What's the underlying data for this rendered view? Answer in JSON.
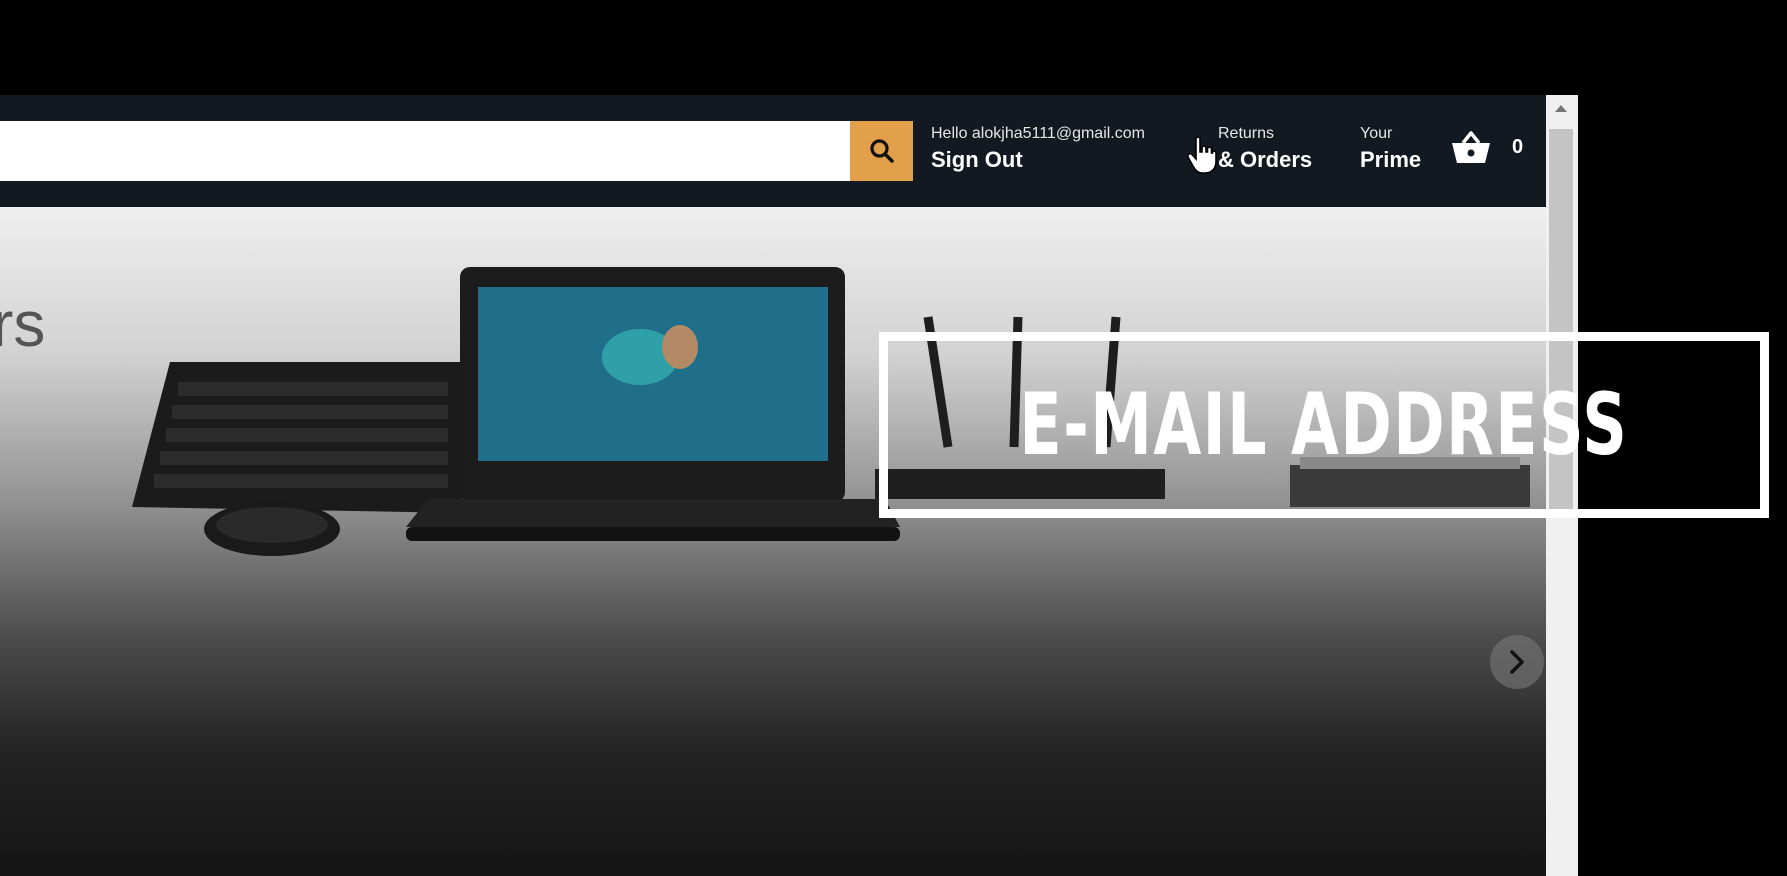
{
  "search": {
    "value": "",
    "placeholder": ""
  },
  "account": {
    "greeting": "Hello alokjha5111@gmail.com",
    "action": "Sign Out"
  },
  "orders": {
    "small": "Returns",
    "big": "& Orders"
  },
  "prime": {
    "small": "Your",
    "big": "Prime"
  },
  "cart": {
    "count": "0"
  },
  "hero": {
    "partial_text": "rs"
  },
  "overlay": {
    "caption": "E-MAIL ADDRESS"
  },
  "colors": {
    "header": "#131921",
    "search_button": "#e3a04a",
    "page_background": "#000000"
  },
  "icons": [
    "search-icon",
    "cart-icon",
    "hand-pointer-icon",
    "chevron-right-icon",
    "scroll-up-arrow-icon"
  ]
}
